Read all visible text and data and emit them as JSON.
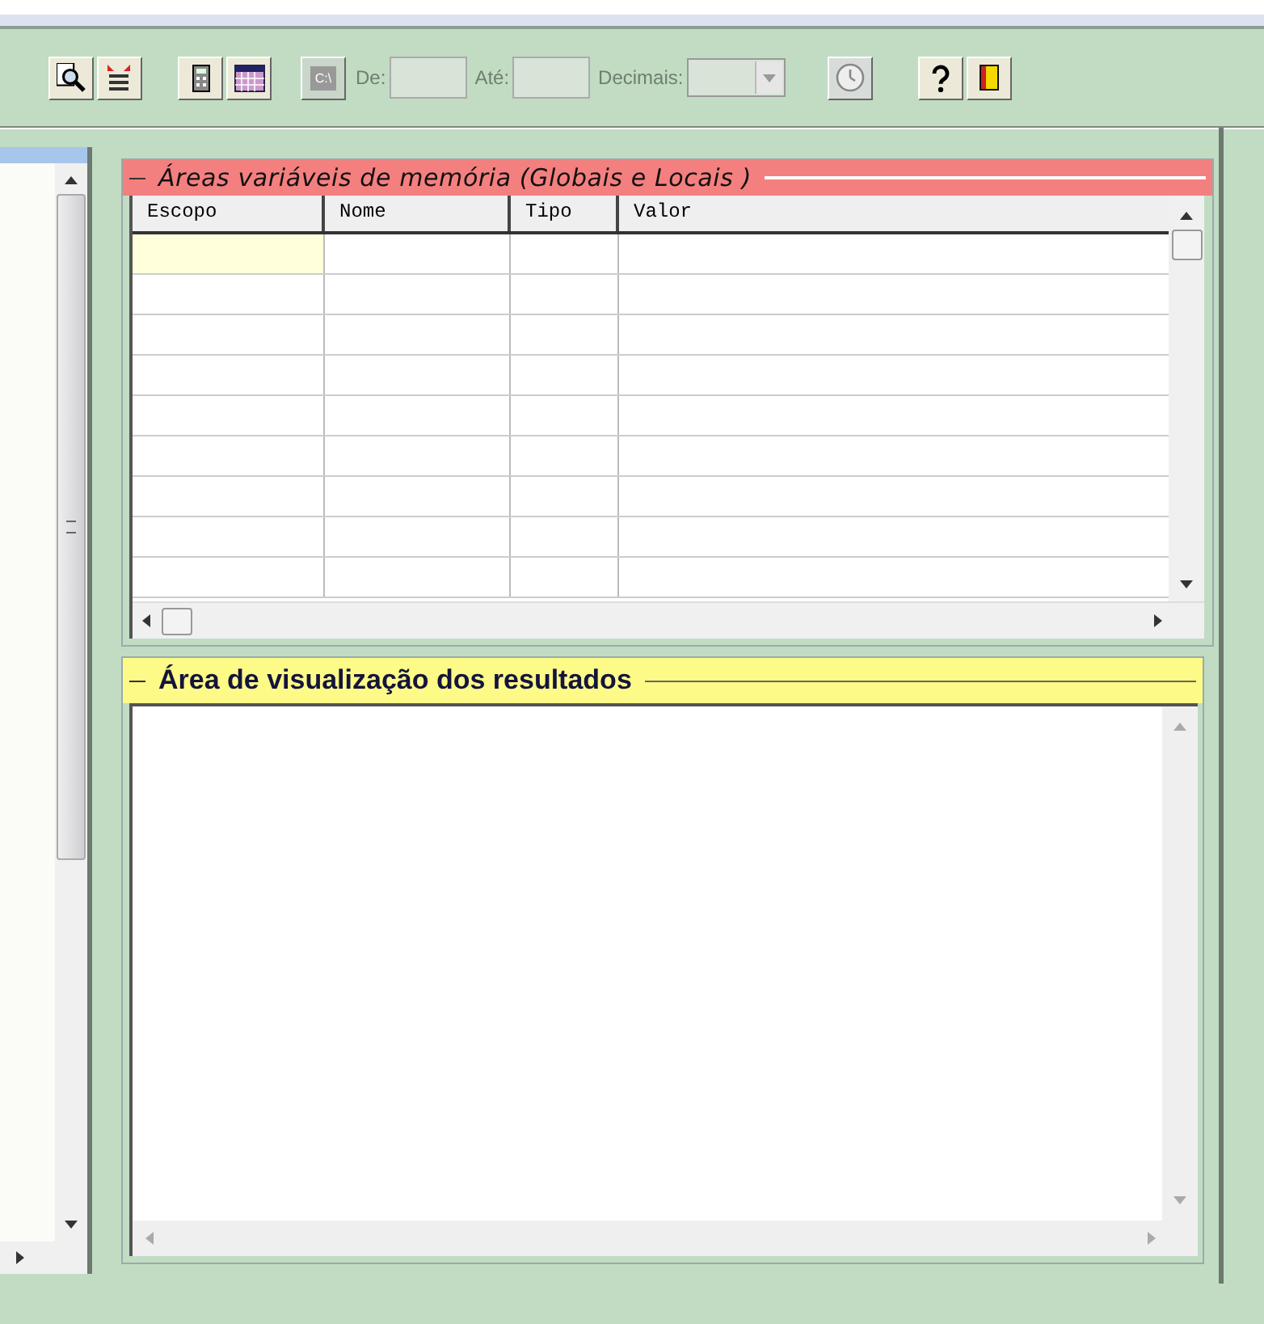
{
  "toolbar": {
    "drive_button": {
      "label": "C:\\",
      "disabled": true
    },
    "fields": [
      {
        "label": "De:",
        "disabled": true
      },
      {
        "label": "Até:",
        "disabled": true
      }
    ],
    "decimals": {
      "label": "Decimais:",
      "disabled": true
    }
  },
  "memory_panel": {
    "title": "Áreas variáveis de memória (Globais e Locais )",
    "columns": [
      "Escopo",
      "Nome",
      "Tipo",
      "Valor"
    ],
    "rows": [
      {
        "selected": true
      },
      {
        "selected": false
      },
      {
        "selected": false
      },
      {
        "selected": false
      },
      {
        "selected": false
      },
      {
        "selected": false
      },
      {
        "selected": false
      },
      {
        "selected": false
      },
      {
        "selected": false
      }
    ]
  },
  "results_panel": {
    "title": "Área de visualização dos resultados"
  }
}
